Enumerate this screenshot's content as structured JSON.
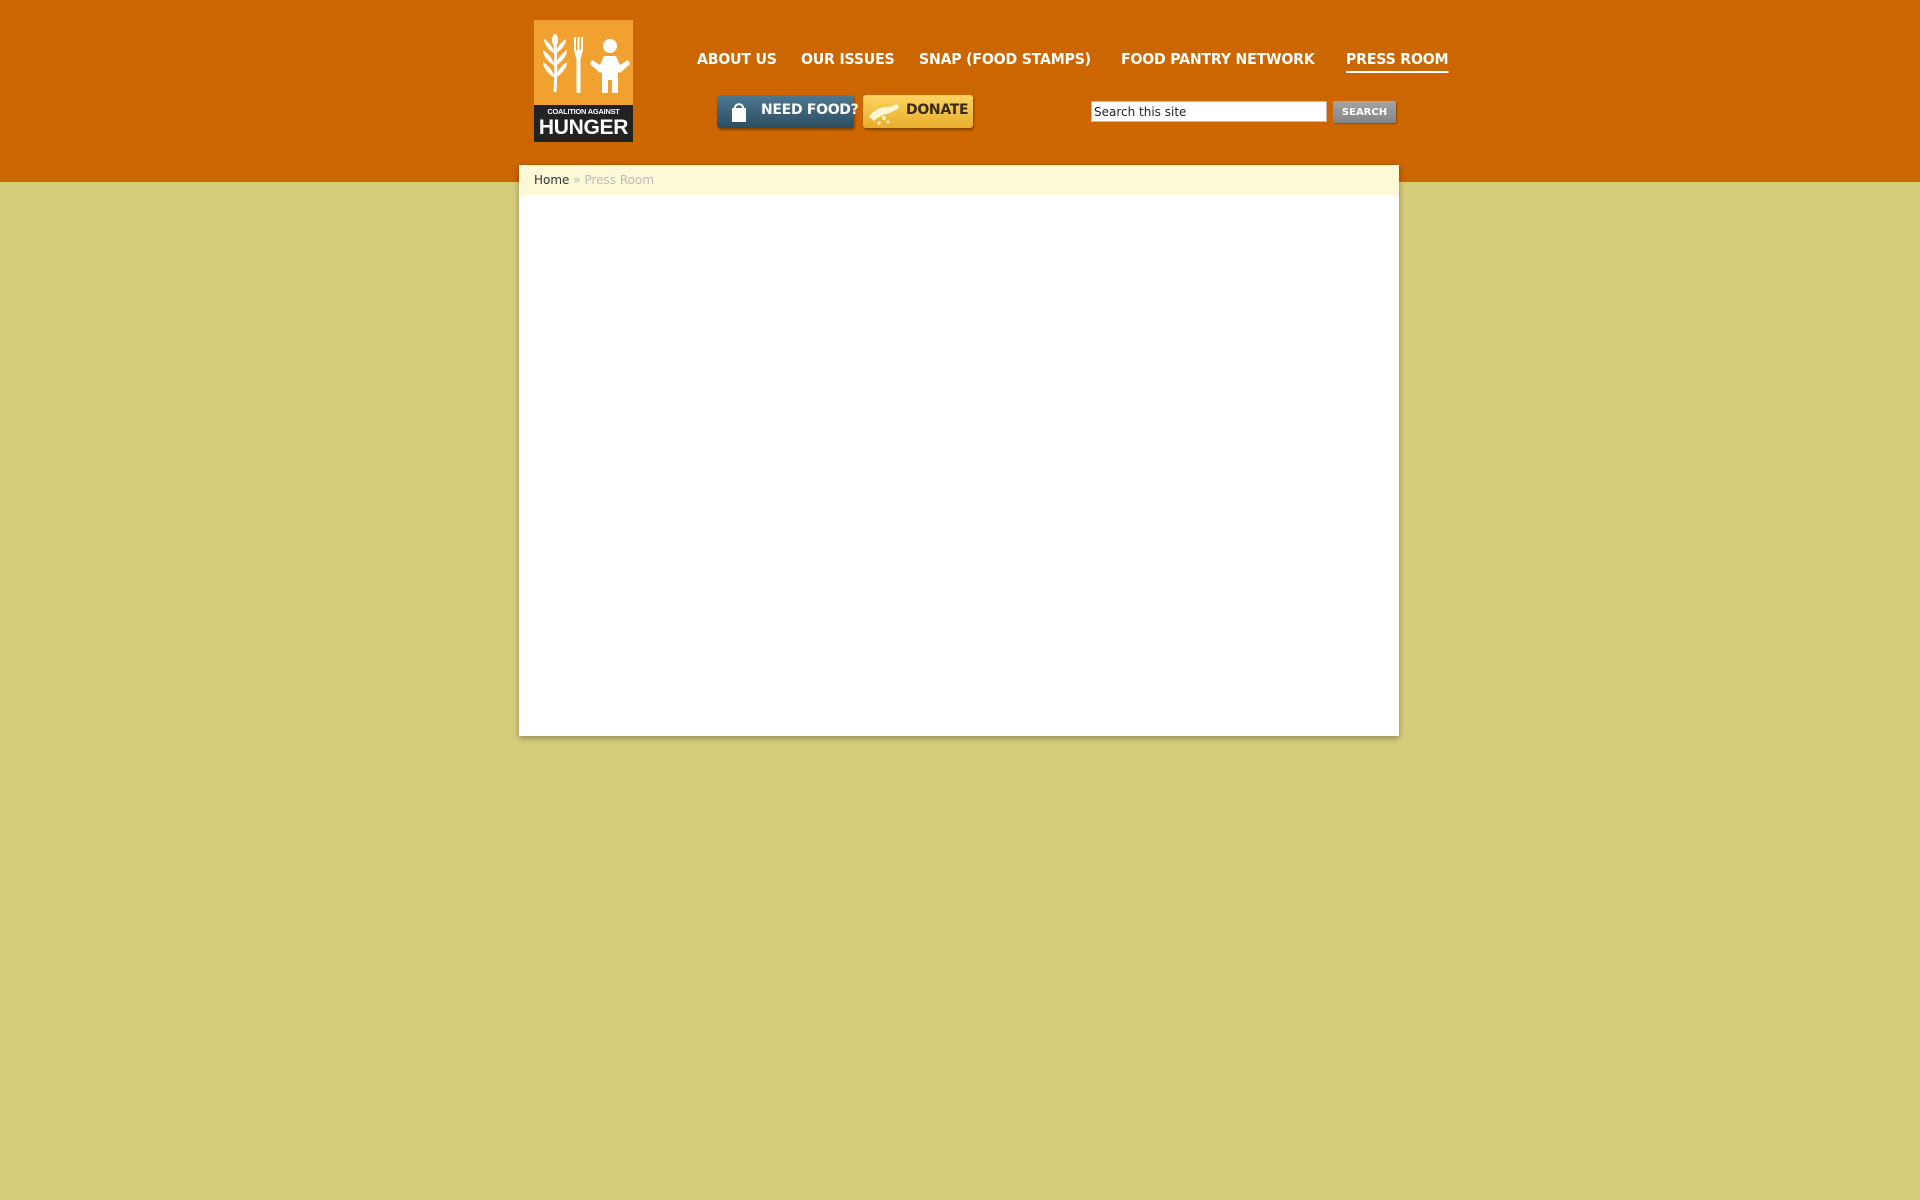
{
  "logo": {
    "line1": "COALITION AGAINST",
    "line2": "HUNGER"
  },
  "nav": [
    {
      "label": "ABOUT US",
      "active": false
    },
    {
      "label": "OUR ISSUES",
      "active": false
    },
    {
      "label": "SNAP (FOOD STAMPS)",
      "active": false
    },
    {
      "label": "FOOD PANTRY NETWORK",
      "active": false
    },
    {
      "label": "PRESS ROOM",
      "active": true
    }
  ],
  "buttons": {
    "need_food": "NEED FOOD?",
    "donate": "DONATE"
  },
  "search": {
    "value": "Search this site",
    "button": "SEARCH"
  },
  "breadcrumb": {
    "home": "Home",
    "separator": "»",
    "current": "Press Room"
  },
  "colors": {
    "header": "#cc6600",
    "background": "#d6cd7b",
    "logo": "#f0a130",
    "need_food": "#2b4d60",
    "donate": "#f5c242"
  }
}
